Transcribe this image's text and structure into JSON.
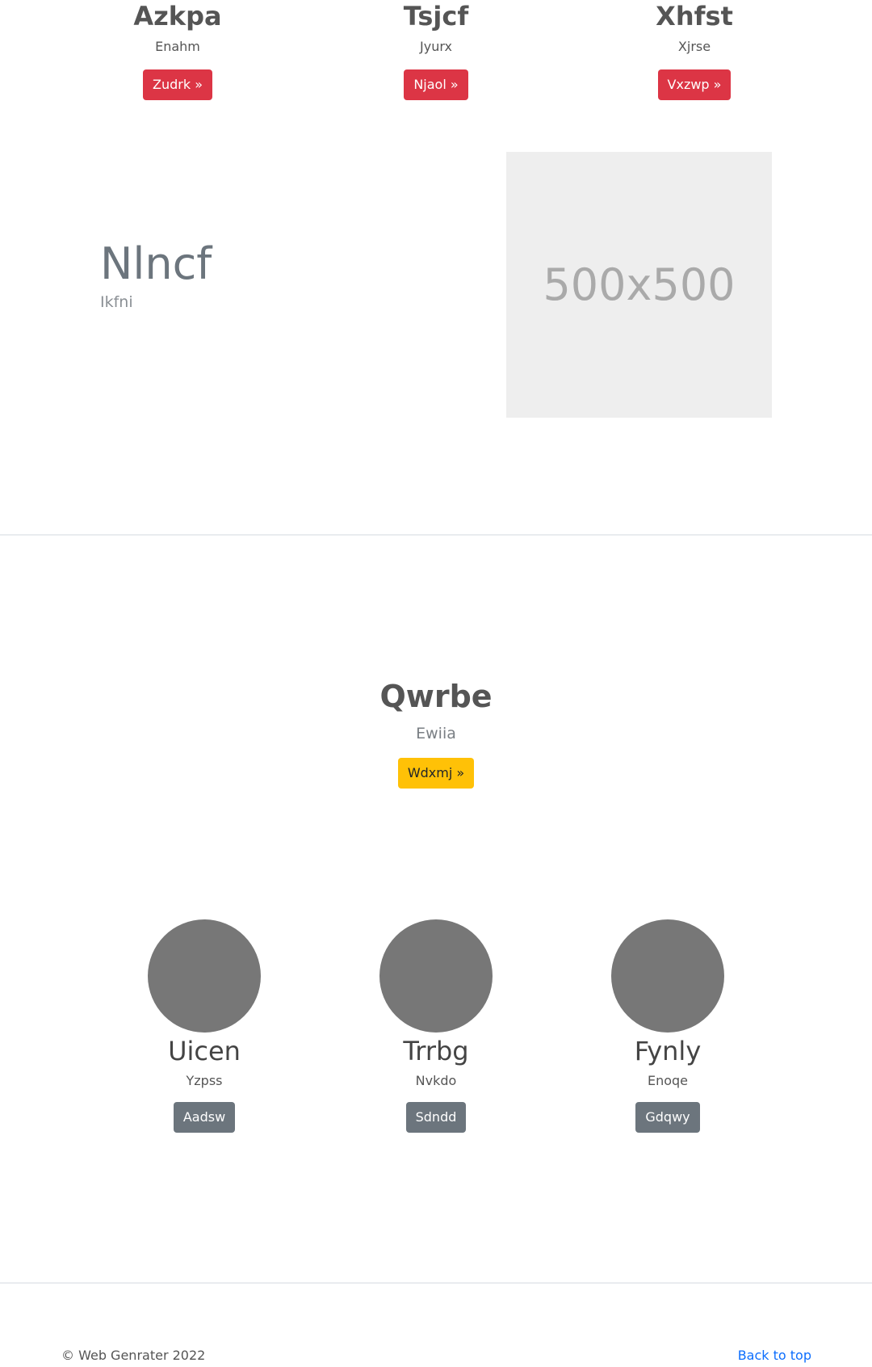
{
  "features": [
    {
      "title": "Azkpa",
      "subtitle": "Enahm",
      "button": "Zudrk »"
    },
    {
      "title": "Tsjcf",
      "subtitle": "Jyurx",
      "button": "Njaol »"
    },
    {
      "title": "Xhfst",
      "subtitle": "Xjrse",
      "button": "Vxzwp »"
    }
  ],
  "featurette": {
    "title": "Nlncf",
    "subtitle": "Ikfni",
    "image_label": "500x500"
  },
  "center": {
    "title": "Qwrbe",
    "subtitle": "Ewiia",
    "button": "Wdxmj »"
  },
  "people": [
    {
      "name": "Uicen",
      "subtitle": "Yzpss",
      "button": "Aadsw"
    },
    {
      "name": "Trrbg",
      "subtitle": "Nvkdo",
      "button": "Sdndd"
    },
    {
      "name": "Fynly",
      "subtitle": "Enoqe",
      "button": "Gdqwy"
    }
  ],
  "footer": {
    "copyright": "© Web Genrater 2022",
    "back_to_top": "Back to top"
  },
  "colors": {
    "danger": "#dc3545",
    "warning": "#ffc107",
    "secondary": "#6c757d",
    "link": "#0d6efd",
    "avatar": "#777777",
    "placeholder_bg": "#eeeeee"
  }
}
